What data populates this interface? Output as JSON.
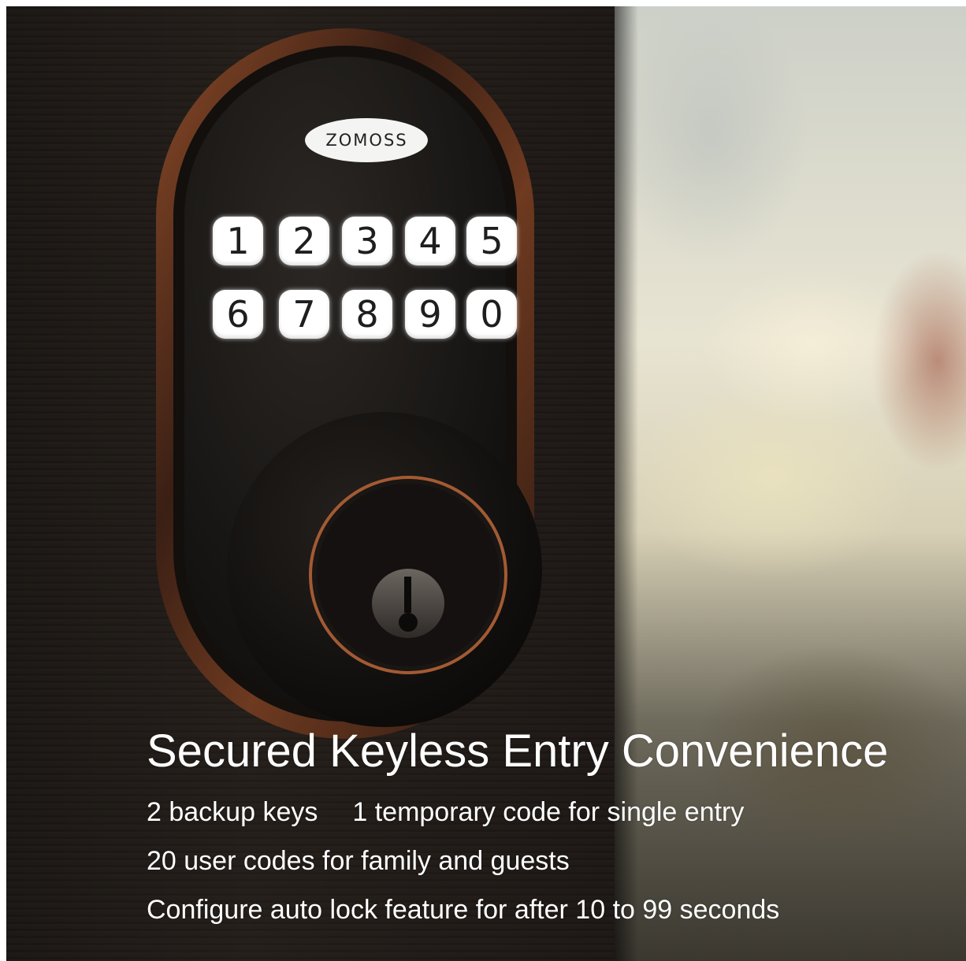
{
  "brand": {
    "logo_text": "ZOMOSS",
    "finish_color": "#7a3f22",
    "body_color": "#141210"
  },
  "keypad": {
    "row1": [
      "1",
      "2",
      "3",
      "4",
      "5"
    ],
    "row2": [
      "6",
      "7",
      "8",
      "9",
      "0"
    ]
  },
  "caption": {
    "headline": "Secured Keyless Entry Convenience",
    "line1_a": "2  backup keys",
    "line1_b": "1 temporary code for single entry",
    "line2": "20 user codes for family and guests",
    "line3": "Configure auto lock feature for after 10 to 99 seconds"
  }
}
